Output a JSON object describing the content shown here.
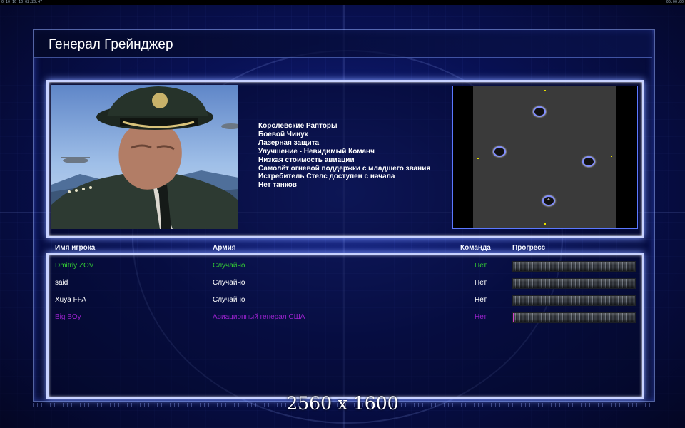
{
  "status": {
    "left": "0 10 10 10 02:20:47",
    "right": "00:00:00"
  },
  "title": "Генерал Грейнджер",
  "features": [
    "Королевские Рапторы",
    "Боевой Чинук",
    "Лазерная защита",
    "Улучшение - Невидимый Команч",
    "Низкая стоимость авиации",
    "Самолёт огневой поддержки с младшего звания",
    "Истребитель Стелс доступен с начала",
    "Нет танков"
  ],
  "minimap": {
    "start_label": "4"
  },
  "columns": {
    "name": "Имя игрока",
    "army": "Армия",
    "team": "Команда",
    "progress": "Прогресс"
  },
  "players": [
    {
      "name": "Dmitriy ZOV",
      "army": "Случайно",
      "team": "Нет",
      "color": "#33cc33",
      "progress": 0
    },
    {
      "name": "said",
      "army": "Случайно",
      "team": "Нет",
      "color": "#ffffff",
      "progress": 0
    },
    {
      "name": "Xuya FFA",
      "army": "Случайно",
      "team": "Нет",
      "color": "#ffffff",
      "progress": 0
    },
    {
      "name": "Big BOy",
      "army": "Авиационный генерал США",
      "team": "Нет",
      "color": "#9922cc",
      "progress": 0.01
    }
  ],
  "resolution": "2560 x 1600"
}
